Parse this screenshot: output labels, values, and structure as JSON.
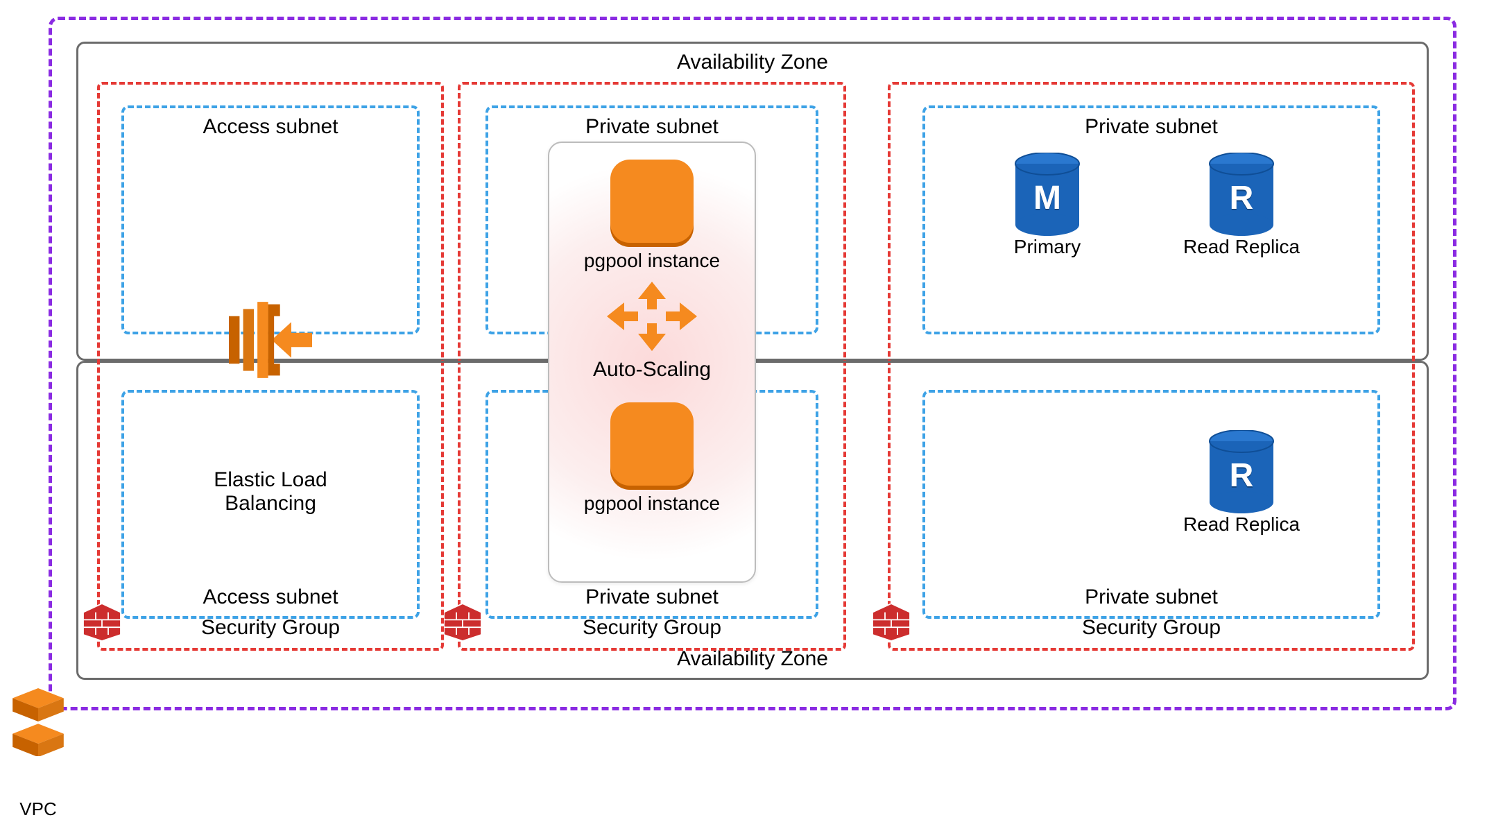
{
  "vpc": {
    "label": "VPC"
  },
  "availability_zones": {
    "top": {
      "label": "Availability Zone"
    },
    "bottom": {
      "label": "Availability Zone"
    }
  },
  "security_groups": [
    {
      "label": "Security Group"
    },
    {
      "label": "Security Group"
    },
    {
      "label": "Security Group"
    }
  ],
  "subnets": {
    "top": [
      {
        "label": "Access subnet"
      },
      {
        "label": "Private subnet"
      },
      {
        "label": "Private subnet"
      }
    ],
    "bottom": [
      {
        "label": "Access subnet"
      },
      {
        "label": "Private subnet"
      },
      {
        "label": "Private subnet"
      }
    ]
  },
  "elb": {
    "label": "Elastic Load Balancing"
  },
  "autoscaling": {
    "label": "Auto-Scaling",
    "instances": [
      {
        "label": "pgpool instance"
      },
      {
        "label": "pgpool instance"
      }
    ]
  },
  "databases": {
    "primary": {
      "letter": "M",
      "label": "Primary"
    },
    "replica_top": {
      "letter": "R",
      "label": "Read Replica"
    },
    "replica_bottom": {
      "letter": "R",
      "label": "Read Replica"
    }
  },
  "colors": {
    "vpc_border": "#8a2be2",
    "az_border": "#6b6b6b",
    "sg_border": "#e53935",
    "subnet_border": "#3da2e6",
    "aws_orange": "#f58a1f",
    "db_blue": "#1b64b8",
    "firewall_red": "#cc2d2d"
  }
}
